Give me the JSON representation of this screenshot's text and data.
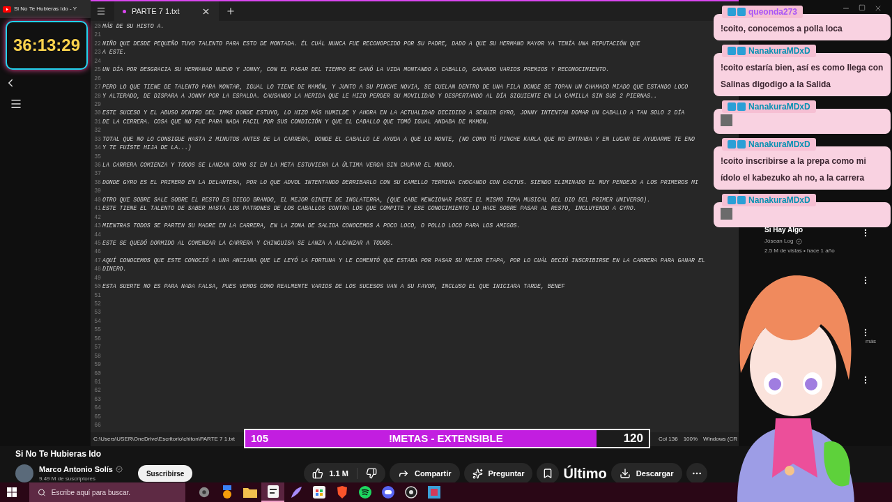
{
  "browser_tab": {
    "title": "Si No Te Hubieras Ido - Y"
  },
  "timer": {
    "text": "36:13:29"
  },
  "editor": {
    "tab": {
      "title": "PARTE 7 1.txt",
      "selected": true
    },
    "lines": [
      {
        "number": "20",
        "text": "MÁS DE SU HISTO A."
      },
      {
        "number": "21"
      },
      {
        "number": "22",
        "text": "NIÑO QUE DESDE PEQUEÑO TUVO TALENTO PARA ESTO DE MONTADA. ÉL CUÁL NUNCA FUE RECONOPCIDO POR SU PADRE, DADO A QUE SU HERMANO MAYOR YA TENÍA UNA REPUTACIÓN QUE"
      },
      {
        "number": "23",
        "text": "A ESTE."
      },
      {
        "number": "24"
      },
      {
        "number": "25",
        "text": "UN DÍA POR DESGRACIA SU HERMANAO NUEVO Y JONNY, CON EL PASAR DEL TIEMPO SE GANÓ LA VIDA MONTANDO A CABALLO, GANANDO VARIOS PREMIOS Y RECONOCIMIENTO."
      },
      {
        "number": "26"
      },
      {
        "number": "27",
        "text": "PERO LO QUE TIENE DE TALENTO PARA MONTAR, IGUAL LO TIENE DE MAMÓN, Y JUNTO A SU PINCHE NOVIA, SE CUELAN DENTRO DE UNA FILA DONDE SE TOPAN UN CHAMACO MIADO QUE ESTANDO LOCO"
      },
      {
        "number": "28",
        "text": "Y ALTERADO, DE DISPARA A JONNY POR LA ESPALDA. CAUSANDO LA HERIDA QUE LE HIZO PERDER SU MOVILIDAD Y DESPERTANDO AL DÍA SIGUIENTE EN LA CAMILLA SIN SUS 2 PIERNAS.."
      },
      {
        "number": "29"
      },
      {
        "number": "30",
        "text": "ESTE SUCESO Y EL ABUSO DENTRO DEL IMMS DONDE ESTUVO, LO HIZO MÁS HUMILDE Y AHORA EN LA ACTUALIDAD DECIDIDO A SEGUIR GYRO, JONNY INTENTAN DOMAR UN CABALLO A TAN SOLO 2 DÍA"
      },
      {
        "number": "31",
        "text": "DE LA CERRERA. COSA QUE NO FUE PARA NADA FACIL POR SUS CONDICIÓN Y QUE EL CABALLO QUE TOMÓ IGUAL ANDABA DE MAMON."
      },
      {
        "number": "32"
      },
      {
        "number": "33",
        "text": "TOTAL QUE NO LO CONSIGUE HASTA 2 MINUTOS ANTES DE LA CARRERA, DONDE EL CABALLO LE AYUDA A QUE LO MONTE, (NO COMO TÚ PINCHE KARLA QUE NO ENTRABA Y EN LUGAR DE AYUDARME TE ENO"
      },
      {
        "number": "34",
        "text": "Y TE FUÍSTE HIJA DE LA...)"
      },
      {
        "number": "35"
      },
      {
        "number": "36",
        "text": "LA CARRERA COMIENZA Y TODOS SE LANZAN COMO SI EN LA META ESTUVIERA LA ÚLTIMA VERGA SIN CHUPAR EL MUNDO."
      },
      {
        "number": "37"
      },
      {
        "number": "38",
        "text": "DONDE GYRO ES EL PRIMERO EN LA DELANTERA, POR LO QUE ADVOL INTENTANDO DERRIBARLO CON SU CAMELLO TERMINA CHOCANDO CON CACTUS. SIENDO ELIMINADO EL MUY PENDEJO A LOS PRIMEROS MI"
      },
      {
        "number": "39"
      },
      {
        "number": "40",
        "text": "OTRO QUE SOBRE SALE SOBRE EL RESTO ES DIEGO BRANDO, EL MEJOR GINETE DE INGLATERRA, (QUE CABE MENCIONAR POSEE EL MISMO TEMA MUSICAL DEL DIO DEL PRIMER UNIVERSO)."
      },
      {
        "number": "41",
        "text": "ESTE TIENE EL TALENTO DE SABER HASTA LOS PATRONES DE LOS CABALLOS CONTRA LOS QUE COMPITE Y ESE CONOCIMIENTO LO HACE SOBRE PASAR AL RESTO, INCLUYENDO A GYRO."
      },
      {
        "number": "42"
      },
      {
        "number": "43",
        "text": "MIENTRAS TODOS SE PARTEN SU MADRE EN LA CARRERA, EN LA ZONA DE SALIDA CONOCEMOS A POCO LOCO, O POLLO LOCO PARA LOS AMIGOS."
      },
      {
        "number": "44"
      },
      {
        "number": "45",
        "text": "ESTE SE QUEDÓ DORMIDO AL COMENZAR LA CARRERA Y CHINGUISA SE LANZA A ALCANZAR A TODOS."
      },
      {
        "number": "46"
      },
      {
        "number": "47",
        "text": "AQUÍ CONOCEMOS QUE ESTE CONOCIÓ A UNA ANCIANA QUE LE LEYÓ LA FORTUNA Y LE COMENTÓ QUE ESTABA POR PASAR SU MEJOR ETAPA, POR LO CUÁL DECIÓ INSCRIBIRSE EN LA CARRERA PARA GANAR EL"
      },
      {
        "number": "48",
        "text": "DINERO."
      },
      {
        "number": "49"
      },
      {
        "number": "50",
        "text": "ESTA SUERTE NO ES PARA NADA FALSA, PUES VEMOS COMO REALMENTE VARIOS DE LOS SUCESOS VAN A SU FAVOR, INCLUSO EL QUE INICIARA TARDE, BENEF"
      },
      {
        "number": "51"
      },
      {
        "number": "52"
      },
      {
        "number": "53"
      },
      {
        "number": "54"
      },
      {
        "number": "55"
      },
      {
        "number": "56"
      },
      {
        "number": "57"
      },
      {
        "number": "58"
      },
      {
        "number": "59"
      },
      {
        "number": "60"
      },
      {
        "number": "61"
      },
      {
        "number": "62"
      },
      {
        "number": "63"
      },
      {
        "number": "64"
      },
      {
        "number": "65"
      },
      {
        "number": "66"
      }
    ],
    "status": {
      "path": "C:\\Users\\USER\\OneDrive\\Escritorio\\chiton\\PARTE 7 1.txt",
      "position": "Col 136",
      "zoom": "100%",
      "line_ending": "Windows (CR"
    }
  },
  "goal_bar": {
    "start": "105",
    "label": "!METAS - EXTENSIBLE",
    "end": "120",
    "level": 0.87
  },
  "chat": [
    {
      "user": "queonda273",
      "color": "#a855f7",
      "kind": "text",
      "text": "!coito, conocemos a polla loca"
    },
    {
      "user": "NanakuraMDxD",
      "color": "#0891b2",
      "kind": "text",
      "text": "!coito estaría bien, así es como llega con Salinas digodigo a la Salida"
    },
    {
      "user": "NanakuraMDxD",
      "color": "#0891b2",
      "kind": "image"
    },
    {
      "user": "NanakuraMDxD",
      "color": "#0891b2",
      "kind": "text",
      "text": "!coito inscribirse a la prepa como mi ídolo el kabezuko ah no, a la carrera"
    },
    {
      "user": "NanakuraMDxD",
      "color": "#0891b2",
      "kind": "image"
    }
  ],
  "recommendation": {
    "title": "Si Hay Algo",
    "channel": "Jósean Log",
    "meta": "2.5 M de vistas • hace 1 año"
  },
  "more_fragment": "más",
  "video": {
    "title": "Si No Te Hubieras Ido",
    "channel": "Marco Antonio Solís",
    "subscribers": "9.49 M de suscriptores",
    "subscribe": "Suscribirse",
    "likes": "1.1 M",
    "actions": [
      {
        "kind": "share",
        "label": "Compartir"
      },
      {
        "kind": "ask",
        "label": "Preguntar"
      },
      {
        "kind": "save"
      },
      {
        "kind": "download",
        "label": "Descargar"
      },
      {
        "kind": "more"
      }
    ]
  },
  "overlay_caption": "Último",
  "taskbar": {
    "search_placeholder": "Escribe aquí para buscar.",
    "apps": [
      {
        "kind": "gear",
        "active": false
      },
      {
        "kind": "medal",
        "active": false
      },
      {
        "kind": "folder",
        "active": false
      },
      {
        "kind": "notepad",
        "active": true
      },
      {
        "kind": "feather",
        "active": false
      },
      {
        "kind": "store",
        "active": false
      },
      {
        "kind": "shield",
        "active": false
      },
      {
        "kind": "music",
        "active": false
      },
      {
        "kind": "chat",
        "active": false
      },
      {
        "kind": "aperture",
        "active": false
      },
      {
        "kind": "tile",
        "active": false
      }
    ]
  }
}
